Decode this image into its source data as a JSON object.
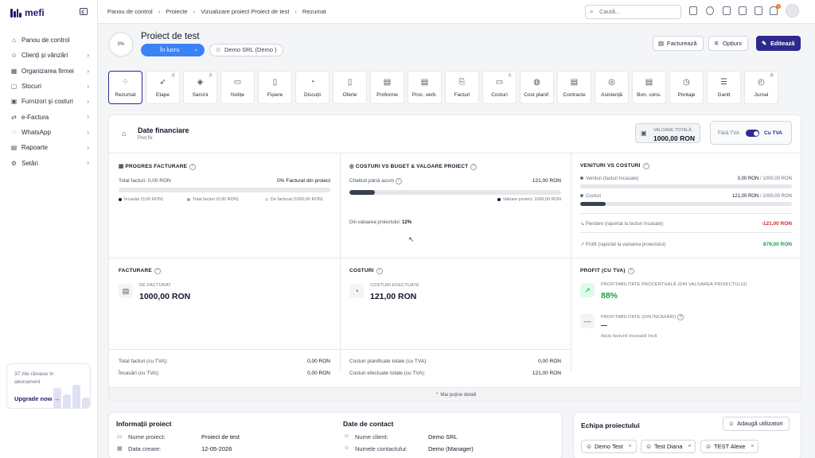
{
  "app": {
    "logo": "mefi"
  },
  "sidebar": {
    "items": [
      {
        "label": "Panou de control",
        "icon": "home-icon",
        "chevron": false
      },
      {
        "label": "Clienți și vânzări",
        "icon": "users-icon",
        "chevron": true
      },
      {
        "label": "Organizarea firmei",
        "icon": "building-icon",
        "chevron": true
      },
      {
        "label": "Stocuri",
        "icon": "box-icon",
        "chevron": true
      },
      {
        "label": "Furnizori și costuri",
        "icon": "truck-icon",
        "chevron": true
      },
      {
        "label": "e-Factura",
        "icon": "efactura-icon",
        "chevron": true
      },
      {
        "label": "WhatsApp",
        "icon": "whatsapp-icon",
        "chevron": true
      },
      {
        "label": "Rapoarte",
        "icon": "report-icon",
        "chevron": true
      },
      {
        "label": "Setări",
        "icon": "gear-icon",
        "chevron": true
      }
    ],
    "upgrade": {
      "text": "37 zile rămase în abonament",
      "cta": "Upgrade now"
    }
  },
  "topbar": {
    "breadcrumbs": [
      "Panou de control",
      "Proiecte",
      "Vizualizare proiect Proiect de test",
      "Rezumat"
    ],
    "search_placeholder": "Caută...",
    "notification_count": "1"
  },
  "project": {
    "progress": "0%",
    "title": "Proiect de test",
    "status": "În lucru",
    "client": "Demo SRL (Demo )",
    "actions": {
      "invoice": "Facturează",
      "options": "Opțiuni",
      "edit": "Editează"
    }
  },
  "tabs": [
    {
      "label": "Rezumat",
      "icon": "grid-icon",
      "count": "",
      "active": true
    },
    {
      "label": "Etape",
      "icon": "rocket-icon",
      "count": "2"
    },
    {
      "label": "Sarcini",
      "icon": "layers-icon",
      "count": "2"
    },
    {
      "label": "Notițe",
      "icon": "folder-icon",
      "count": ""
    },
    {
      "label": "Fișiere",
      "icon": "file-icon",
      "count": ""
    },
    {
      "label": "Discuții",
      "icon": "chat-icon",
      "count": ""
    },
    {
      "label": "Oferte",
      "icon": "offer-icon",
      "count": ""
    },
    {
      "label": "Proforme",
      "icon": "proforma-icon",
      "count": ""
    },
    {
      "label": "Proc. verb.",
      "icon": "document-icon",
      "count": ""
    },
    {
      "label": "Facturi",
      "icon": "invoice-icon",
      "count": ""
    },
    {
      "label": "Costuri",
      "icon": "cash-icon",
      "count": "1"
    },
    {
      "label": "Cost planif.",
      "icon": "piggybank-icon",
      "count": ""
    },
    {
      "label": "Contracte",
      "icon": "contract-icon",
      "count": ""
    },
    {
      "label": "Asistență",
      "icon": "support-icon",
      "count": ""
    },
    {
      "label": "Bon. cons.",
      "icon": "receipt-icon",
      "count": ""
    },
    {
      "label": "Pontaje",
      "icon": "clock-icon",
      "count": ""
    },
    {
      "label": "Gantt",
      "icon": "gantt-icon",
      "count": ""
    },
    {
      "label": "Jurnal",
      "icon": "history-icon",
      "count": "8"
    }
  ],
  "financial": {
    "title": "Date financiare",
    "subtitle": "Preț fix",
    "total_label": "VALOARE TOTALĂ",
    "total_value": "1000,00 RON",
    "tva_off": "Fără TVA",
    "tva_on": "Cu TVA",
    "billing_progress": {
      "title": "PROGRES FACTURARE",
      "total_label": "Total facturi: 0,00 RON",
      "percent_label": "0% Facturat din proiect",
      "fill": 0,
      "legend": [
        "Încasări (0,00 RON)",
        "Total facturi (0,00 RON)",
        "De facturat (1000,00 RON)"
      ]
    },
    "costs_vs_budget": {
      "title": "COSTURI VS BUGET & VALOARE PROIECT",
      "spent_label": "Cheltuit până acum",
      "spent_value": "121,00 RON",
      "fill": 0.121,
      "legend": "Valoare proiect: 1000,00 RON",
      "ratio_label": "Din valoarea proiectului:",
      "ratio_value": "12%"
    },
    "revenue_vs_costs": {
      "title": "VENITURI VS COSTURI",
      "revenue_label": "Venituri (facturi încasate)",
      "revenue_value": "0,00 RON",
      "revenue_of": "/ 1000,00 RON",
      "revenue_fill": 0,
      "costs_label": "Costuri",
      "costs_value": "121,00 RON",
      "costs_of": "/ 1000,00 RON",
      "costs_fill": 0.121,
      "loss_label": "Pierdere (raportat la facturi încasate)",
      "loss_value": "-121,00 RON",
      "profit_label": "Profit (raportat la valoarea proiectului)",
      "profit_value": "879,00 RON"
    },
    "billing": {
      "title": "FACTURARE",
      "label": "DE FACTURAT",
      "value": "1000,00 RON",
      "rows": [
        {
          "k": "Total facturi (cu TVA):",
          "v": "0,00 RON"
        },
        {
          "k": "Încasări (cu TVA):",
          "v": "0,00 RON"
        }
      ]
    },
    "costs": {
      "title": "COSTURI",
      "label": "COSTURI EFECTUATE",
      "value": "121,00 RON",
      "rows": [
        {
          "k": "Costuri planificate totale (cu TVA):",
          "v": "0,00 RON"
        },
        {
          "k": "Costuri efectuate totale (cu TVA):",
          "v": "121,00 RON"
        }
      ]
    },
    "profit": {
      "title": "PROFIT (CU TVA)",
      "pct_label": "PROFITABILITATE PROCENTUALĂ (DIN VALOAREA PROIECTULUI)",
      "pct_value": "88%",
      "cash_label": "PROFITABILITATE (DIN ÎNCASĂRI)",
      "cash_value": "—",
      "cash_note": "Nicio factură încasată încă"
    },
    "less_details": "Mai puține detalii"
  },
  "project_info": {
    "title": "Informații proiect",
    "rows": [
      {
        "k": "Nume proiect:",
        "v": "Proiect de test"
      },
      {
        "k": "Data creare:",
        "v": "12-05-2026"
      }
    ]
  },
  "contact": {
    "title": "Date de contact",
    "rows": [
      {
        "k": "Nume client:",
        "v": "Demo SRL"
      },
      {
        "k": "Numele contactului:",
        "v": "Demo (Manager)"
      }
    ]
  },
  "team": {
    "title": "Echipa proiectului",
    "add_label": "Adaugă utilizatori",
    "members": [
      "Demo Test",
      "Test Diana",
      "TEST Alexe"
    ]
  },
  "colors": {
    "brand": "#2d2a8c",
    "status": "#3b82f6",
    "loss": "#dc2626",
    "profit": "#16a34a"
  }
}
